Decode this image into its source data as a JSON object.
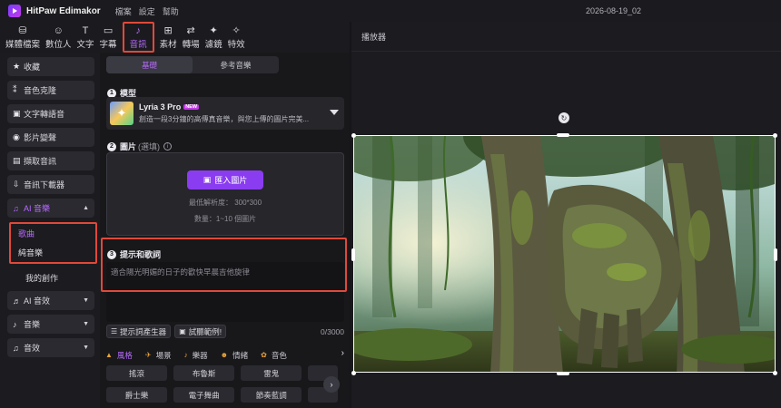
{
  "titlebar": {
    "app_name": "HitPaw Edimakor",
    "menus": [
      "檔案",
      "設定",
      "幫助"
    ],
    "project_time": "2026-08-19_02"
  },
  "toolbar": {
    "tools": [
      {
        "label": "媒體檔案",
        "icon": "media-icon"
      },
      {
        "label": "數位人",
        "icon": "avatar-person-icon"
      },
      {
        "label": "文字",
        "icon": "text-icon"
      },
      {
        "label": "字幕",
        "icon": "subtitle-icon"
      },
      {
        "label": "音訊",
        "icon": "music-note-icon"
      },
      {
        "label": "素材",
        "icon": "stickers-grid-icon"
      },
      {
        "label": "轉場",
        "icon": "transition-arrows-icon"
      },
      {
        "label": "濾鏡",
        "icon": "filter-sparkle-icon"
      },
      {
        "label": "特效",
        "icon": "effects-icon"
      }
    ],
    "active": "音訊"
  },
  "sidebar": {
    "items": [
      {
        "label": "收藏",
        "icon": "star-icon"
      },
      {
        "label": "音色克隆",
        "icon": "voice-clone-icon"
      },
      {
        "label": "文字轉語音",
        "icon": "text-to-speech-icon"
      },
      {
        "label": "影片變聲",
        "icon": "voice-changer-icon"
      },
      {
        "label": "擷取音訊",
        "icon": "extract-audio-icon"
      },
      {
        "label": "音訊下載器",
        "icon": "download-icon"
      }
    ],
    "ai_music": {
      "label": "AI 音樂",
      "icon": "ai-music-icon",
      "sub_items": [
        "歌曲",
        "純音樂"
      ],
      "active_sub": "歌曲",
      "extra": "我的創作"
    },
    "groups": [
      {
        "label": "AI 音效",
        "icon": "ai-sfx-icon"
      },
      {
        "label": "音樂",
        "icon": "music-icon"
      },
      {
        "label": "音效",
        "icon": "sound-effect-icon"
      }
    ]
  },
  "center": {
    "tabs": [
      "基礎",
      "參考音樂"
    ],
    "active_tab": "基礎",
    "model_section": {
      "number": "1",
      "title": "模型"
    },
    "model": {
      "name": "Lyria 3 Pro",
      "badge": "NEW",
      "description": "創造一段3分鐘的高傳真音樂，與您上傳的圖片完美..."
    },
    "image_section": {
      "number": "2",
      "title": "圖片",
      "optional": "(選填)"
    },
    "image_box": {
      "import_label": "匯入圖片",
      "min_resolution": "最低解析度： 300*300",
      "count": "數量：1~10 個圖片"
    },
    "prompt_section": {
      "number": "3",
      "title": "提示和歌詞"
    },
    "prompt": {
      "placeholder": "適合陽光明媚的日子的歡快早晨吉他旋律",
      "generator_label": "提示詞產生器",
      "example_label": "試聽範例!",
      "counter": "0/3000"
    },
    "tag_tabs": [
      {
        "label": "風格",
        "icon": "style-icon"
      },
      {
        "label": "場景",
        "icon": "scene-icon"
      },
      {
        "label": "樂器",
        "icon": "instrument-icon"
      },
      {
        "label": "情緒",
        "icon": "mood-icon"
      },
      {
        "label": "音色",
        "icon": "timbre-icon"
      }
    ],
    "active_tag_tab": "風格",
    "tags": [
      [
        "搖滾",
        "布魯斯",
        "雷鬼",
        ""
      ],
      [
        "爵士樂",
        "電子舞曲",
        "節奏藍調",
        ""
      ]
    ]
  },
  "player": {
    "title": "播放器"
  },
  "colors": {
    "accent": "#b86bff",
    "highlight_box": "#e0493a",
    "import_button": "#8a3cf0"
  }
}
